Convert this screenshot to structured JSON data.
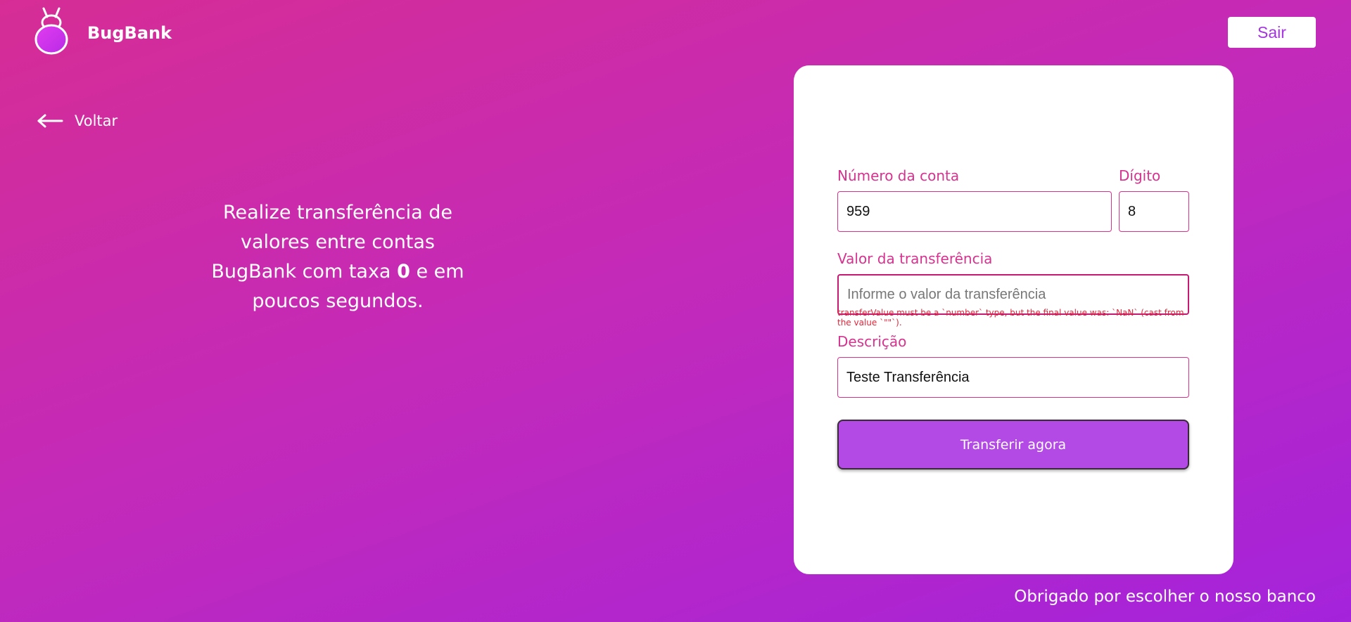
{
  "header": {
    "brand_name": "BugBank",
    "logout_label": "Sair"
  },
  "nav": {
    "back_label": "Voltar"
  },
  "promo": {
    "text_before": "Realize transferência de valores entre contas BugBank com taxa",
    "text_bold": "0",
    "text_after": "e em poucos segundos."
  },
  "form": {
    "account_number": {
      "label": "Número da conta",
      "value": "959"
    },
    "digit": {
      "label": "Dígito",
      "value": "8"
    },
    "transfer_value": {
      "label": "Valor da transferência",
      "value": "",
      "placeholder": "Informe o valor da transferência",
      "error": "transferValue must be a `number` type, but the final value was: `NaN` (cast from the value `\"\"`)."
    },
    "description": {
      "label": "Descrição",
      "value": "Teste Transferência"
    },
    "submit_label": "Transferir agora"
  },
  "footer": {
    "text": "Obrigado por escolher o nosso banco"
  },
  "colors": {
    "brand_pink": "#d6338f",
    "brand_purple": "#a423db",
    "button_purple": "#b44ae6",
    "error_red": "#e0263b"
  },
  "icons": {
    "logo": "bug-logo-icon",
    "back": "arrow-left-icon"
  }
}
